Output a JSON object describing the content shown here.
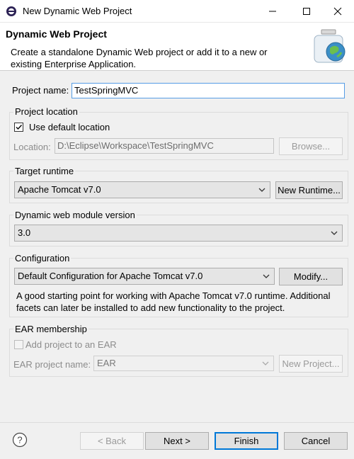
{
  "window": {
    "title": "New Dynamic Web Project"
  },
  "banner": {
    "title": "Dynamic Web Project",
    "description": "Create a standalone Dynamic Web project or add it to a new or existing Enterprise Application."
  },
  "project_name": {
    "label": "Project name:",
    "value": "TestSpringMVC"
  },
  "project_location": {
    "title": "Project location",
    "use_default_label": "Use default location",
    "use_default_checked": true,
    "location_label": "Location:",
    "location_value": "D:\\Eclipse\\Workspace\\TestSpringMVC",
    "browse_label": "Browse..."
  },
  "target_runtime": {
    "title": "Target runtime",
    "selected": "Apache Tomcat v7.0",
    "new_runtime_label": "New Runtime..."
  },
  "module_version": {
    "title": "Dynamic web module version",
    "selected": "3.0"
  },
  "configuration": {
    "title": "Configuration",
    "selected": "Default Configuration for Apache Tomcat v7.0",
    "modify_label": "Modify...",
    "description": "A good starting point for working with Apache Tomcat v7.0 runtime. Additional facets can later be installed to add new functionality to the project."
  },
  "ear": {
    "title": "EAR membership",
    "add_label": "Add project to an EAR",
    "add_checked": false,
    "project_name_label": "EAR project name:",
    "project_name_value": "EAR",
    "new_project_label": "New Project..."
  },
  "footer": {
    "back_label": "< Back",
    "next_label": "Next >",
    "finish_label": "Finish",
    "cancel_label": "Cancel"
  },
  "icons": {
    "app": "eclipse-icon",
    "banner": "web-project-globe-jar-icon",
    "help": "help-icon"
  },
  "colors": {
    "focus_border": "#569de5",
    "default_button_border": "#0078d7"
  }
}
